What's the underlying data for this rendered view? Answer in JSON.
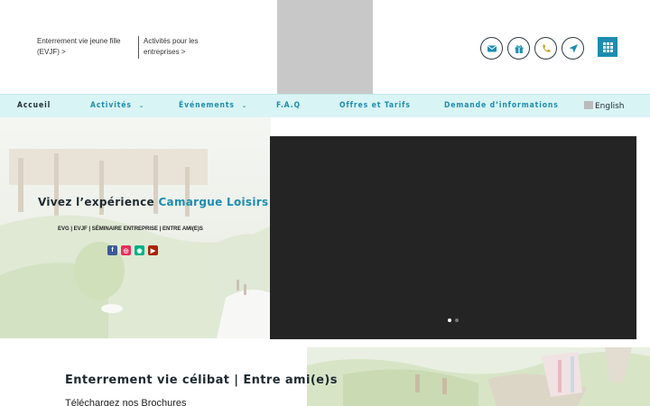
{
  "header": {
    "links": [
      {
        "label": "Enterrement vie jeune fille (EVJF) >"
      },
      {
        "label": "Activités pour les entreprises >"
      }
    ],
    "icons": [
      "mail-icon",
      "gift-icon",
      "phone-icon",
      "location-arrow-icon",
      "grid-menu-icon"
    ]
  },
  "nav": {
    "items": [
      {
        "label": "Accueil",
        "has_dropdown": false
      },
      {
        "label": "Activités",
        "has_dropdown": true
      },
      {
        "label": "Événements",
        "has_dropdown": true
      },
      {
        "label": "F.A.Q",
        "has_dropdown": false
      },
      {
        "label": "Offres et Tarifs",
        "has_dropdown": false
      },
      {
        "label": "Demande d’informations",
        "has_dropdown": false
      }
    ],
    "language": "English"
  },
  "hero": {
    "title_prefix": "Vivez l’expérience ",
    "title_accent": "Camargue Loisirs",
    "subtitle": "EVG | EVJF | SÉMINAIRE ENTREPRISE | ENTRE AMI(E)S",
    "social": [
      {
        "name": "facebook",
        "glyph": "f",
        "color": "#3b5998"
      },
      {
        "name": "instagram",
        "glyph": "◎",
        "color": "#ea2c59"
      },
      {
        "name": "tripadvisor",
        "glyph": "◉",
        "color": "#00af87"
      },
      {
        "name": "youtube",
        "glyph": "▶",
        "color": "#a82400"
      }
    ]
  },
  "slider": {
    "slide_count": 2,
    "active_slide": 1
  },
  "section": {
    "title": "Enterrement vie célibat | Entre ami(e)s",
    "brochure_text": "Téléchargez nos Brochures"
  },
  "colors": {
    "accent": "#1c8db0",
    "nav_bg": "#d9f4f4",
    "dark": "#1e2a30",
    "phone_icon": "#c9a227"
  }
}
